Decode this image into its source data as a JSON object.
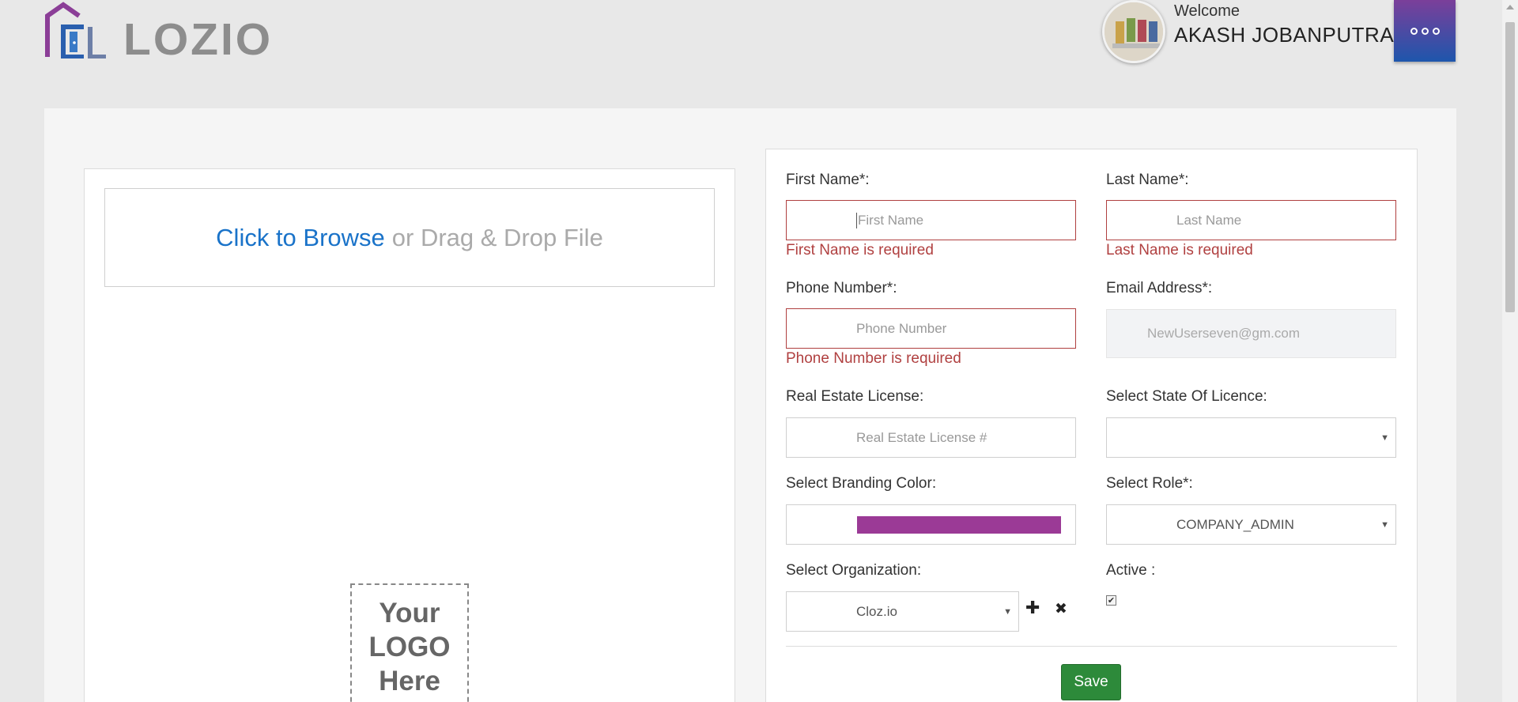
{
  "header": {
    "logo_text": "LOZIO",
    "welcome": "Welcome",
    "username": "AKASH JOBANPUTRA",
    "menu_icon": "more-dots-icon"
  },
  "upload": {
    "browse_text": "Click to Browse",
    "rest_text": "or Drag & Drop File",
    "logo_placeholder": [
      "Your",
      "LOGO",
      "Here"
    ]
  },
  "form": {
    "first_name": {
      "label": "First Name*:",
      "placeholder": "First Name",
      "error": "First Name is required"
    },
    "last_name": {
      "label": "Last Name*:",
      "placeholder": "Last Name",
      "error": "Last Name is required"
    },
    "phone": {
      "label": "Phone Number*:",
      "placeholder": "Phone Number",
      "error": "Phone Number is required"
    },
    "email": {
      "label": "Email Address*:",
      "value": "NewUserseven@gm.com"
    },
    "license": {
      "label": "Real Estate License:",
      "placeholder": "Real Estate License #"
    },
    "state": {
      "label": "Select State Of Licence:",
      "value": ""
    },
    "branding_color": {
      "label": "Select Branding Color:",
      "color": "#9b3a96"
    },
    "role": {
      "label": "Select Role*:",
      "value": "COMPANY_ADMIN"
    },
    "organization": {
      "label": "Select Organization:",
      "value": "Cloz.io"
    },
    "active": {
      "label": "Active :",
      "checked": true
    },
    "save_label": "Save"
  },
  "colors": {
    "accent_blue": "#1a73c9",
    "error_red": "#b04040",
    "save_green": "#2d8a3a",
    "menu_gradient_top": "#7b3f9a",
    "menu_gradient_bottom": "#1e56ac"
  }
}
